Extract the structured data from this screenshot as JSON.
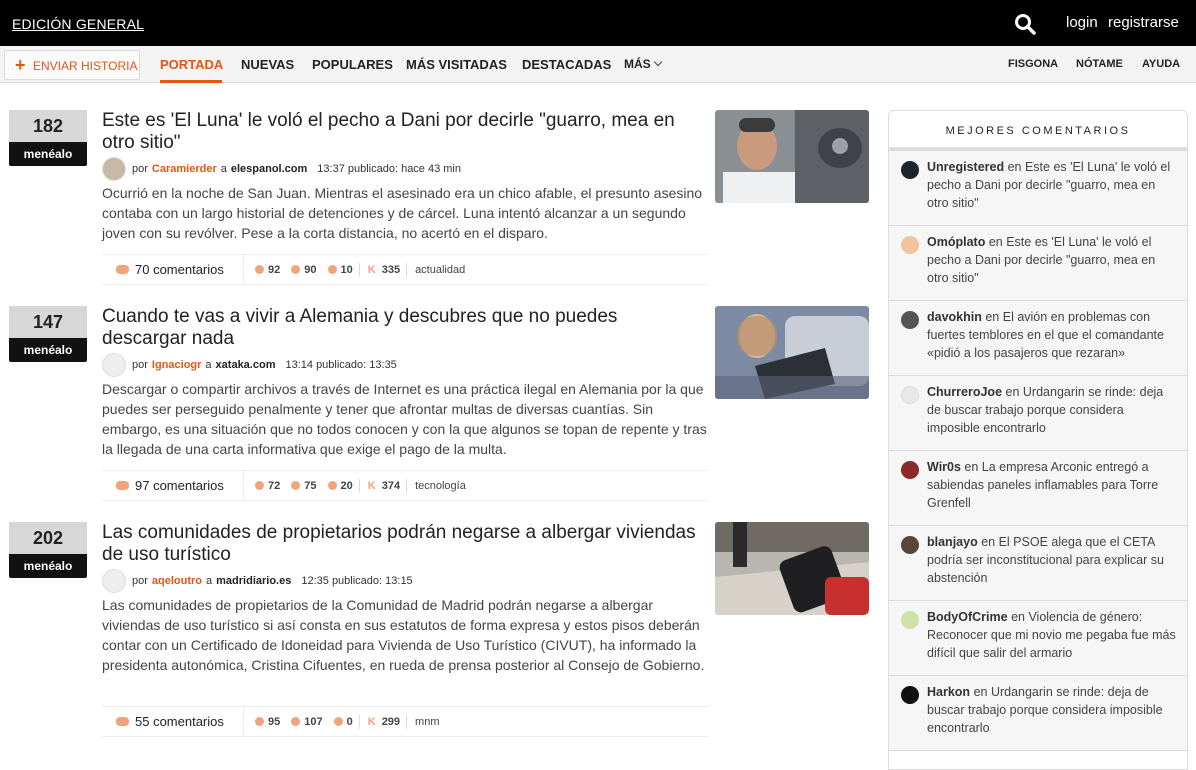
{
  "header": {
    "edition": "EDICIÓN GENERAL",
    "login": "login",
    "register": "registrarse"
  },
  "nav": {
    "send_story": "ENVIAR HISTORIA",
    "tabs": [
      "PORTADA",
      "NUEVAS",
      "POPULARES",
      "MÁS VISITADAS",
      "DESTACADAS",
      "MÁS"
    ],
    "right_tabs": [
      "FISGONA",
      "NÓTAME",
      "AYUDA"
    ],
    "accent": "#e35614"
  },
  "news": [
    {
      "votes": "182",
      "menealo": "menéalo",
      "title": "Este es 'El Luna' le voló el pecho a Dani por decirle \"guarro, mea en otro sitio\"",
      "by": "por",
      "author": "Caramierder",
      "at": "a",
      "domain": "elespanol.com",
      "time": "13:37 publicado: hace 43 min",
      "body": "Ocurrió en la noche de San Juan. Mientras el asesinado era un chico afable, el presunto asesino contaba con un largo historial de detenciones y de cárcel. Luna intentó alcanzar a un segundo joven con su revólver. Pese a la corta distancia, no acertó en el disparo.",
      "comments": "70 comentarios",
      "up": "92",
      "anon": "90",
      "neg": "10",
      "karma_label": "K",
      "karma": "335",
      "sub": "actualidad"
    },
    {
      "votes": "147",
      "menealo": "menéalo",
      "title": "Cuando te vas a vivir a Alemania y descubres que no puedes descargar nada",
      "by": "por",
      "author": "Ignaciogr",
      "at": "a",
      "domain": "xataka.com",
      "time": "13:14 publicado: 13:35",
      "body": "Descargar o compartir archivos a través de Internet es una práctica ilegal en Alemania por la que puedes ser perseguido penalmente y tener que afrontar multas de diversas cuantías. Sin embargo, es una situación que no todos conocen y con la que algunos se topan de repente y tras la llegada de una carta informativa que exige el pago de la multa.",
      "comments": "97 comentarios",
      "up": "72",
      "anon": "75",
      "neg": "20",
      "karma_label": "K",
      "karma": "374",
      "sub": "tecnología"
    },
    {
      "votes": "202",
      "menealo": "menéalo",
      "title": "Las comunidades de propietarios podrán negarse a albergar viviendas de uso turístico",
      "by": "por",
      "author": "aqeloutro",
      "at": "a",
      "domain": "madridiario.es",
      "time": "12:35 publicado: 13:15",
      "body": "Las comunidades de propietarios de la Comunidad de Madrid podrán negarse a albergar viviendas de uso turístico si así consta en sus estatutos de forma expresa y estos pisos deberán contar con un Certificado de Idoneidad para Vivienda de Uso Turístico (CIVUT), ha informado la presidenta autonómica, Cristina Cifuentes, en rueda de prensa posterior al Consejo de Gobierno.",
      "comments": "55 comentarios",
      "up": "95",
      "anon": "107",
      "neg": "0",
      "karma_label": "K",
      "karma": "299",
      "sub": "mnm"
    }
  ],
  "sidebar": {
    "title": "MEJORES COMENTARIOS",
    "items": [
      {
        "user": "Unregistered",
        "text": "en Este es 'El Luna' le voló el pecho a Dani por decirle \"guarro, mea en otro sitio\""
      },
      {
        "user": "Omóplato",
        "text": "en Este es 'El Luna' le voló el pecho a Dani por decirle \"guarro, mea en otro sitio\""
      },
      {
        "user": "davokhin",
        "text": "en El avión en problemas con fuertes temblores en el que el comandante «pidió a los pasajeros que rezaran»"
      },
      {
        "user": "ChurreroJoe",
        "text": "en Urdangarin se rinde: deja de buscar trabajo porque considera imposible encontrarlo"
      },
      {
        "user": "Wir0s",
        "text": "en La empresa Arconic entregó a sabiendas paneles inflamables para Torre Grenfell"
      },
      {
        "user": "blanjayo",
        "text": "en El PSOE alega que el CETA podría ser inconstitucional para explicar su abstención"
      },
      {
        "user": "BodyOfCrime",
        "text": "en Violencia de género: Reconocer que mi novio me pegaba fue más difícil que salir del armario"
      },
      {
        "user": "Harkon",
        "text": "en Urdangarin se rinde: deja de buscar trabajo porque considera imposible encontrarlo"
      }
    ]
  }
}
